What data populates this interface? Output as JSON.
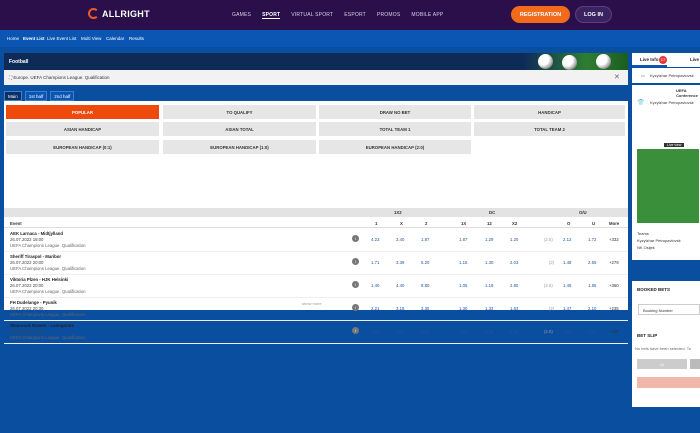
{
  "header": {
    "brand": "ALLRIGHT",
    "nav": [
      {
        "label": "GAMES"
      },
      {
        "label": "SPORT",
        "active": true
      },
      {
        "label": "VIRTUAL SPORT"
      },
      {
        "label": "ESPORT"
      },
      {
        "label": "PROMOS"
      },
      {
        "label": "MOBILE APP"
      }
    ],
    "register": "REGISTRATION",
    "login": "LOG IN"
  },
  "subnav": [
    {
      "label": "Home"
    },
    {
      "label": "Event List",
      "active": true
    },
    {
      "label": "Live Event List"
    },
    {
      "label": "Multi View"
    },
    {
      "label": "Calendar"
    },
    {
      "label": "Results"
    }
  ],
  "banner": {
    "title": "Football"
  },
  "league": {
    "path": "Europe. UEFA Champions League. Qualification"
  },
  "period_tabs": [
    {
      "label": "Main",
      "active": true
    },
    {
      "label": "1st half"
    },
    {
      "label": "2nd half"
    }
  ],
  "markets": [
    {
      "label": "POPULAR",
      "active": true
    },
    {
      "label": "TO QUALIFY"
    },
    {
      "label": "DRAW NO BET"
    },
    {
      "label": "HANDICAP"
    },
    {
      "label": "ASIAN HANDICAP"
    },
    {
      "label": "ASIAN TOTAL"
    },
    {
      "label": "TOTAL TEAM 1"
    },
    {
      "label": "TOTAL TEAM 2"
    },
    {
      "label": "EUROPEAN HANDICAP (0:1)"
    },
    {
      "label": "EUROPEAN HANDICAP (1:0)"
    },
    {
      "label": "EUROPEAN HANDICAP (2:0)"
    }
  ],
  "table": {
    "groups": [
      "1X2",
      "DC",
      "O/U"
    ],
    "columns": [
      "Event",
      "1",
      "X",
      "2",
      "1X",
      "12",
      "X2",
      "O",
      "U",
      "More"
    ],
    "rows": [
      {
        "name": "AEK Larnaca - Midtjylland",
        "date": "26.07.2022 18:00",
        "comp": "UEFA Champions League. Qualification",
        "o1": "4.23",
        "ox": "3.40",
        "o2": "1.87",
        "o1x": "1.87",
        "o12": "1.29",
        "ox2": "1.20",
        "hcp": "(2.5)",
        "over": "2.12",
        "under": "1.72",
        "more": "+332"
      },
      {
        "name": "Sheriff Tiraspol - Maribor",
        "date": "26.07.2022 20:00",
        "comp": "UEFA Champions League. Qualification",
        "o1": "1.71",
        "ox": "3.39",
        "o2": "5.20",
        "o1x": "1.15",
        "o12": "1.30",
        "ox2": "2.03",
        "hcp": "(2)",
        "over": "1.48",
        "under": "2.55",
        "more": "+279"
      },
      {
        "name": "Viktoria Plzen - HJK Helsinki",
        "date": "26.07.2022 20:00",
        "comp": "UEFA Champions League. Qualification",
        "o1": "1.40",
        "ox": "4.40",
        "o2": "8.80",
        "o1x": "1.05",
        "o12": "1.19",
        "ox2": "2.80",
        "hcp": "(2.5)",
        "over": "1.45",
        "under": "1.85",
        "more": "+360"
      },
      {
        "name": "FH Dudelange - Pyunik",
        "date": "26.07.2022 20:30",
        "comp": "UEFA Champions League. Qualification",
        "o1": "2.21",
        "ox": "3.15",
        "o2": "3.35",
        "o1x": "1.30",
        "o12": "1.33",
        "ox2": "1.63",
        "hcp": "(2)",
        "over": "1.47",
        "under": "2.10",
        "more": "+235"
      },
      {
        "name": "Shamrock Rovers - Ludogorets",
        "date": "26.07.2022 22:30",
        "comp": "UEFA Champions League. Qualification",
        "o1": "3.33",
        "ox": "3.25",
        "o2": "2.24",
        "o1x": "1.62",
        "o12": "1.31",
        "ox2": "1.32",
        "hcp": "(2.5)",
        "over": "2.14",
        "under": "1.71",
        "more": "+440"
      }
    ],
    "show_more": "show more"
  },
  "sidebar": {
    "tab_live_info": "Live Info",
    "badge": "17",
    "tab_live": "Live",
    "match_title": "Kyzylzhar Petropavlovsk",
    "league": "UEFA Conference",
    "team": "Kyzylzhar Petropavlovsk",
    "live_view": "Live view",
    "stats_header": "Teams",
    "stat_team1": "Kyzylzhar Petropavlovsk",
    "stat_team2": "NK Osijek",
    "booked_bets": "BOOKED BETS",
    "booking_placeholder": "Booking Number",
    "bet_slip": "BET SLIP",
    "no_bets": "No bets have been selected. To",
    "btn_stake": "10"
  },
  "colors": {
    "header_bg": "#2a0f4a",
    "accent": "#f26b1d",
    "page_bg": "#0a4ea0",
    "active_market": "#ee4a0d",
    "odds": "#1e56a0"
  }
}
